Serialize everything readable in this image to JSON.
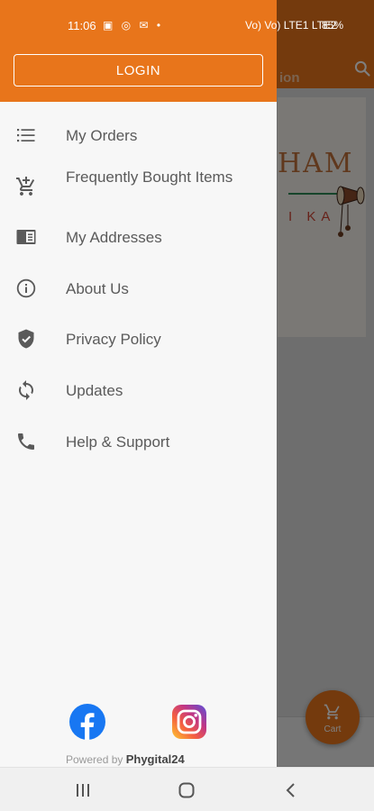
{
  "status_bar": {
    "time": "11:06",
    "left_icons": "▣ ◎ ✉ •",
    "network": "Vo) Vo) LTE1 LTE2",
    "battery": "85%"
  },
  "background": {
    "toolbar_title": "ion",
    "banner_text_top": "HAM",
    "banner_text_bottom": "I KA",
    "cart_label": "Cart"
  },
  "drawer": {
    "login_label": "LOGIN",
    "menu": [
      {
        "label": "My Orders",
        "icon": "list-icon"
      },
      {
        "label": "Frequently Bought Items",
        "icon": "cart-add-icon"
      },
      {
        "label": "My Addresses",
        "icon": "address-card-icon"
      },
      {
        "label": "About Us",
        "icon": "info-icon"
      },
      {
        "label": "Privacy Policy",
        "icon": "shield-icon"
      },
      {
        "label": "Updates",
        "icon": "refresh-icon"
      },
      {
        "label": "Help & Support",
        "icon": "phone-icon"
      }
    ],
    "powered_prefix": "Powered by",
    "powered_brand": "Phygital24"
  },
  "colors": {
    "accent": "#e8751b",
    "drawer_bg": "#f7f7f7",
    "menu_text": "#5a5a5a",
    "facebook": "#1877f2"
  }
}
